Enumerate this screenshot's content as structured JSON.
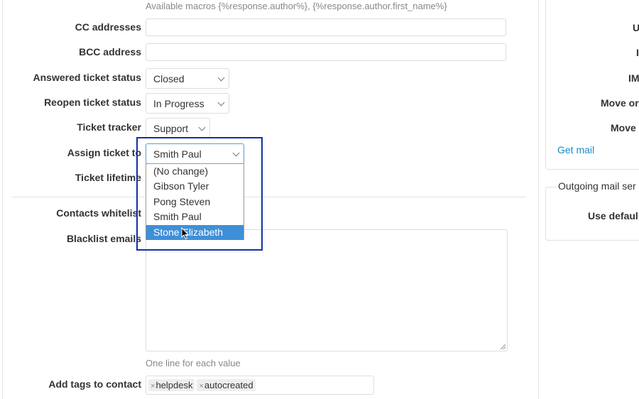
{
  "form": {
    "macros_hint": "Available macros {%response.author%}, {%response.author.first_name%}",
    "cc_label": "CC addresses",
    "cc_value": "",
    "bcc_label": "BCC address",
    "bcc_value": "",
    "answered_status_label": "Answered ticket status",
    "answered_status_value": "Closed",
    "reopen_status_label": "Reopen ticket status",
    "reopen_status_value": "In Progress",
    "tracker_label": "Ticket tracker",
    "tracker_value": "Support",
    "assign_label": "Assign ticket to",
    "assign_value": "Smith Paul",
    "assign_options": [
      "(No change)",
      "Gibson Tyler",
      "Pong Steven",
      "Smith Paul",
      "Stone Elizabeth"
    ],
    "assign_highlighted": "Stone Elizabeth",
    "lifetime_label": "Ticket lifetime",
    "whitelist_label": "Contacts whitelist",
    "blacklist_label": "Blacklist emails",
    "blacklist_hint": "One line for each value",
    "tags_label": "Add tags to contact",
    "tags": [
      "helpdesk",
      "autocreated"
    ]
  },
  "sidebar": {
    "labels": [
      "U",
      "I",
      "IM",
      "Move or",
      "Move"
    ],
    "get_mail_link": "Get mail",
    "outgoing_legend": "Outgoing mail ser",
    "use_default_label": "Use defaul"
  },
  "colors": {
    "link": "#1a8cc8",
    "highlight": "#3f8fd8",
    "focus_box": "#1330a8"
  }
}
